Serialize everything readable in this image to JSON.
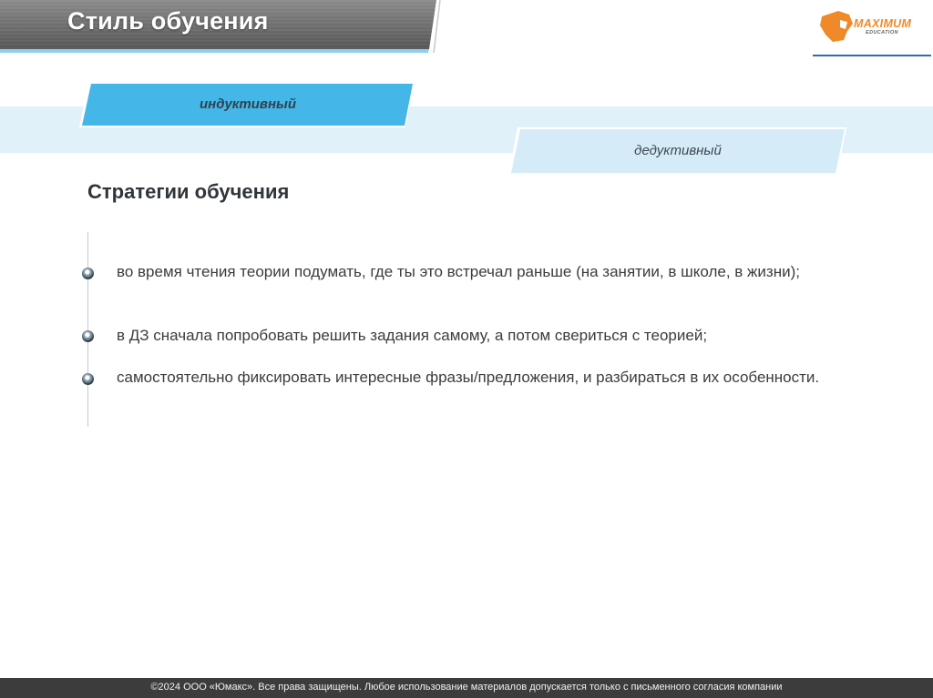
{
  "header": {
    "title": "Стиль обучения"
  },
  "logo": {
    "name": "MAXIMUM",
    "sub": "EDUCATION"
  },
  "tabs": [
    {
      "label": "индуктивный",
      "color": "#45b6e8"
    },
    {
      "label": "дедуктивный",
      "color": "#d5ecf8"
    }
  ],
  "main": {
    "subheading": "Стратегии обучения",
    "items": [
      {
        "text": "во время чтения теории подумать, где ты это встречал раньше (на занятии, в школе, в жизни);"
      },
      {
        "text": "в ДЗ сначала попробовать решить задания самому, а потом свериться с теорией;"
      },
      {
        "text": "самостоятельно фиксировать интересные фразы/предложения, и разбираться в их особенности."
      }
    ]
  },
  "footer": {
    "text": "©2024 ООО «Юмакс». Все права защищены. Любое использование материалов допускается только с письменного согласия компании"
  }
}
